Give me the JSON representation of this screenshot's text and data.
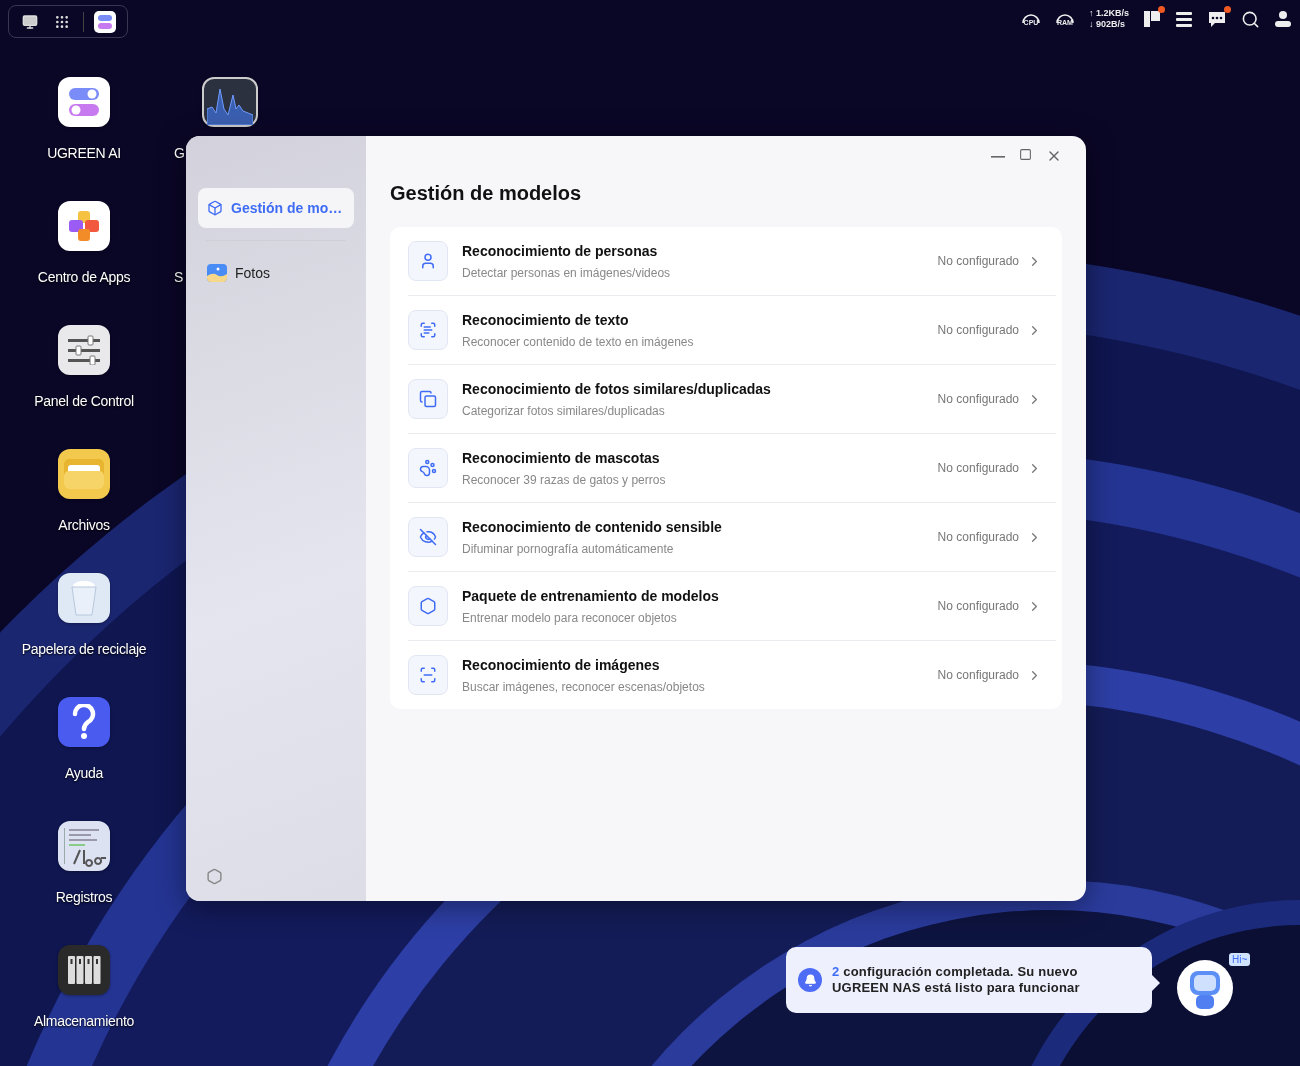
{
  "taskbar": {
    "apps": [
      {
        "kind": "desktop",
        "selected": false
      },
      {
        "kind": "launcher",
        "selected": false
      },
      {
        "kind": "ugreen-ai",
        "selected": true
      }
    ]
  },
  "tray": {
    "cpu": "CPU",
    "ram": "RAM",
    "upload": "↑ 1.2KB/s",
    "download": "↓ 902B/s",
    "widgets_alert": true,
    "messages_alert": true
  },
  "desktop": {
    "icons": [
      {
        "label": "UGREEN AI",
        "kind": "toggles"
      },
      {
        "label": "Centro de Apps",
        "kind": "apps"
      },
      {
        "label": "Panel de Control",
        "kind": "sliders"
      },
      {
        "label": "Archivos",
        "kind": "folder"
      },
      {
        "label": "Papelera de reciclaje",
        "kind": "trash"
      },
      {
        "label": "Ayuda",
        "kind": "help"
      },
      {
        "label": "Registros",
        "kind": "logs"
      },
      {
        "label": "Almacenamiento",
        "kind": "storage"
      }
    ],
    "second_column": [
      {
        "label": "G",
        "kind": "monitor"
      },
      {
        "label": "S",
        "kind": "hidden"
      }
    ]
  },
  "window": {
    "sidebar": {
      "items": [
        {
          "label": "Gestión de mo…",
          "kind": "models",
          "selected": true
        },
        {
          "label": "Fotos",
          "kind": "photos",
          "selected": false
        }
      ]
    },
    "title": "Gestión de modelos",
    "models": [
      {
        "title": "Reconocimiento de personas",
        "description": "Detectar personas en imágenes/videos",
        "status": "No configurado"
      },
      {
        "title": "Reconocimiento de texto",
        "description": "Reconocer contenido de texto en imágenes",
        "status": "No configurado"
      },
      {
        "title": "Reconocimiento de fotos similares/duplicadas",
        "description": "Categorizar fotos similares/duplicadas",
        "status": "No configurado"
      },
      {
        "title": "Reconocimiento de mascotas",
        "description": "Reconocer 39 razas de gatos y perros",
        "status": "No configurado"
      },
      {
        "title": "Reconocimiento de contenido sensible",
        "description": "Difuminar pornografía automáticamente",
        "status": "No configurado"
      },
      {
        "title": "Paquete de entrenamiento de modelos",
        "description": "Entrenar modelo para reconocer objetos",
        "status": "No configurado"
      },
      {
        "title": "Reconocimiento de imágenes",
        "description": "Buscar imágenes, reconocer escenas/objetos",
        "status": "No configurado"
      }
    ]
  },
  "notification": {
    "count": "2",
    "message": "configuración completada. Su nuevo UGREEN NAS está listo para funcionar",
    "assistant_bubble": "Hi~"
  }
}
